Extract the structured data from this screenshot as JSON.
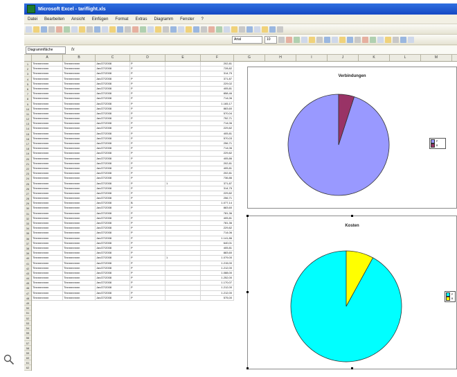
{
  "window": {
    "title": "Microsoft Excel - tariflight.xls"
  },
  "menu": [
    "Datei",
    "Bearbeiten",
    "Ansicht",
    "Einfügen",
    "Format",
    "Extras",
    "Diagramm",
    "Fenster",
    "?"
  ],
  "toolbar": {
    "font_name": "Arial",
    "font_size": "10"
  },
  "formula_bar": {
    "name_box": "Diagrammfläche",
    "fx": "fx"
  },
  "columns": [
    "A",
    "B",
    "C",
    "D",
    "E",
    "F",
    "G",
    "H",
    "I",
    "J",
    "K",
    "L",
    "M",
    "N"
  ],
  "row_numbers": [
    "1",
    "2",
    "3",
    "4",
    "5",
    "6",
    "7",
    "8",
    "9",
    "10",
    "11",
    "12",
    "13",
    "14",
    "15",
    "16",
    "17",
    "18",
    "19",
    "20",
    "21",
    "22",
    "23",
    "24",
    "25",
    "26",
    "27",
    "28",
    "29",
    "30",
    "31",
    "32",
    "33",
    "34",
    "35",
    "36",
    "37",
    "38",
    "39",
    "40",
    "41",
    "42",
    "43",
    "44",
    "45",
    "46",
    "47",
    "48",
    "49",
    "50",
    "51",
    "52",
    "53",
    "54",
    "55",
    "56",
    "57",
    "58",
    "59",
    "60",
    "61",
    "62"
  ],
  "rows": [
    {
      "a": "Tlnnnnnnnnn",
      "b": "Tlnnnnnnnnn",
      "c": "Jan/27/2008",
      "d": "P",
      "e": "",
      "f": "202,81"
    },
    {
      "a": "Tlnnnnnnnnn",
      "b": "Tlnnnnnnnnn",
      "c": "Jan/27/2008",
      "d": "P",
      "e": "",
      "f": "728,82"
    },
    {
      "a": "Tlnnnnnnnnn",
      "b": "Tlnnnnnnnnn",
      "c": "Jan/27/2008",
      "d": "P",
      "e": "",
      "f": "314,75"
    },
    {
      "a": "Tlnnnnnnnnn",
      "b": "Tlnnnnnnnnn",
      "c": "Jan/27/2008",
      "d": "P",
      "e": "",
      "f": "371,87"
    },
    {
      "a": "Tlnnnnnnnnn",
      "b": "Tlnnnnnnnnn",
      "c": "Jan/27/2008",
      "d": "P",
      "e": "",
      "f": "229,02"
    },
    {
      "a": "Tlnnnnnnnnn",
      "b": "Tlnnnnnnnnn",
      "c": "Jan/27/2008",
      "d": "P",
      "e": "",
      "f": "405,81"
    },
    {
      "a": "Tlnnnnnnnnn",
      "b": "Tlnnnnnnnnn",
      "c": "Jan/27/2008",
      "d": "P",
      "e": "",
      "f": "858,46"
    },
    {
      "a": "Tlnnnnnnnnn",
      "b": "Tlnnnnnnnnn",
      "c": "Jan/27/2008",
      "d": "P",
      "e": "",
      "f": "714,06"
    },
    {
      "a": "Tlnnnnnnnnn",
      "b": "Tlnnnnnnnnn",
      "c": "Jan/27/2008",
      "d": "P",
      "e": "",
      "f": "1.165,17"
    },
    {
      "a": "Tlnnnnnnnnn",
      "b": "Tlnnnnnnnnn",
      "c": "Jan/27/2008",
      "d": "P",
      "e": "",
      "f": "883,60"
    },
    {
      "a": "Tlnnnnnnnnn",
      "b": "Tlnnnnnnnnn",
      "c": "Jan/27/2008",
      "d": "P",
      "e": "",
      "f": "570,04"
    },
    {
      "a": "Tlnnnnnnnnn",
      "b": "Tlnnnnnnnnn",
      "c": "Jan/27/2008",
      "d": "P",
      "e": "",
      "f": "752,71"
    },
    {
      "a": "Tlnnnnnnnnn",
      "b": "Tlnnnnnnnnn",
      "c": "Jan/27/2008",
      "d": "P",
      "e": "",
      "f": "714,06"
    },
    {
      "a": "Tlnnnnnnnnn",
      "b": "Tlnnnnnnnnn",
      "c": "Jan/27/2008",
      "d": "P",
      "e": "",
      "f": "229,82"
    },
    {
      "a": "Tlnnnnnnnnn",
      "b": "Tlnnnnnnnnn",
      "c": "Jan/27/2008",
      "d": "P",
      "e": "",
      "f": "405,81"
    },
    {
      "a": "Tlnnnnnnnnn",
      "b": "Tlnnnnnnnnn",
      "c": "Jan/27/2008",
      "d": "P",
      "e": "",
      "f": "570,03"
    },
    {
      "a": "Tlnnnnnnnnn",
      "b": "Tlnnnnnnnnn",
      "c": "Jan/27/2008",
      "d": "P",
      "e": "",
      "f": "256,71"
    },
    {
      "a": "Tlnnnnnnnnn",
      "b": "Tlnnnnnnnnn",
      "c": "Jan/27/2008",
      "d": "P",
      "e": "",
      "f": "714,06"
    },
    {
      "a": "Tlnnnnnnnnn",
      "b": "Tlnnnnnnnnn",
      "c": "Jan/27/2008",
      "d": "P",
      "e": "",
      "f": "229,82"
    },
    {
      "a": "Tlnnnnnnnnn",
      "b": "Tlnnnnnnnnn",
      "c": "Jan/27/2008",
      "d": "P",
      "e": "",
      "f": "405,86"
    },
    {
      "a": "Tlnnnnnnnnn",
      "b": "Tlnnnnnnnnn",
      "c": "Jan/27/2008",
      "d": "P",
      "e": "",
      "f": "202,81"
    },
    {
      "a": "Tlnnnnnnnnn",
      "b": "Tlnnnnnnnnn",
      "c": "Jan/27/2008",
      "d": "P",
      "e": "",
      "f": "405,81"
    },
    {
      "a": "Tlnnnnnnnnn",
      "b": "Tlnnnnnnnnn",
      "c": "Jan/27/2008",
      "d": "P",
      "e": "",
      "f": "202,81"
    },
    {
      "a": "Tlnnnnnnnnn",
      "b": "Tlnnnnnnnnn",
      "c": "Jan/27/2008",
      "d": "P",
      "e": "",
      "f": "736,86"
    },
    {
      "a": "Tlnnnnnnnnn",
      "b": "Tlnnnnnnnnn",
      "c": "Jan/27/2008",
      "d": "P",
      "e": "1",
      "f": "371,87"
    },
    {
      "a": "Tlnnnnnnnnn",
      "b": "Tlnnnnnnnnn",
      "c": "Jan/27/2008",
      "d": "P",
      "e": "",
      "f": "314,75"
    },
    {
      "a": "Tlnnnnnnnnn",
      "b": "Tlnnnnnnnnn",
      "c": "Jan/27/2008",
      "d": "P",
      "e": "",
      "f": "229,82"
    },
    {
      "a": "Tlnnnnnnnnn",
      "b": "Tlnnnnnnnnn",
      "c": "Jan/27/2008",
      "d": "P",
      "e": "",
      "f": "256,71"
    },
    {
      "a": "Tlnnnnnnnnn",
      "b": "Tlnnnnnnnnn",
      "c": "Jan/27/2008",
      "d": "B",
      "e": "",
      "f": "1.077,14"
    },
    {
      "a": "Tlnnnnnnnnn",
      "b": "Tlnnnnnnnnn",
      "c": "Jan/27/2008",
      "d": "P",
      "e": "",
      "f": "883,60"
    },
    {
      "a": "Tlnnnnnnnnn",
      "b": "Tlnnnnnnnnn",
      "c": "Jan/27/2008",
      "d": "P",
      "e": "",
      "f": "781,36"
    },
    {
      "a": "Tlnnnnnnnnn",
      "b": "Tlnnnnnnnnn",
      "c": "Jan/27/2008",
      "d": "P",
      "e": "",
      "f": "405,81"
    },
    {
      "a": "Tlnnnnnnnnn",
      "b": "Tlnnnnnnnnn",
      "c": "Jan/27/2008",
      "d": "P",
      "e": "",
      "f": "781,36"
    },
    {
      "a": "Tlnnnnnnnnn",
      "b": "Tlnnnnnnnnn",
      "c": "Jan/27/2008",
      "d": "P",
      "e": "",
      "f": "229,82"
    },
    {
      "a": "Tlnnnnnnnnn",
      "b": "Tlnnnnnnnnn",
      "c": "Jan/27/2008",
      "d": "P",
      "e": "",
      "f": "714,06"
    },
    {
      "a": "Tlnnnnnnnnn",
      "b": "Tlnnnnnnnnn",
      "c": "Jan/27/2008",
      "d": "P",
      "e": "",
      "f": "1.141,86"
    },
    {
      "a": "Tlnnnnnnnnn",
      "b": "Tlnnnnnnnnn",
      "c": "Jan/27/2008",
      "d": "P",
      "e": "",
      "f": "640,01"
    },
    {
      "a": "Tlnnnnnnnnn",
      "b": "Tlnnnnnnnnn",
      "c": "Jan/27/2008",
      "d": "P",
      "e": "",
      "f": "405,81"
    },
    {
      "a": "Tlnnnnnnnnn",
      "b": "Tlnnnnnnnnn",
      "c": "Jan/27/2008",
      "d": "P",
      "e": "",
      "f": "883,60"
    },
    {
      "a": "Tlnnnnnnnnn",
      "b": "Tlnnnnnnnnn",
      "c": "Jan/27/2008",
      "d": "P",
      "e": "1",
      "f": "1.079,00"
    },
    {
      "a": "Tlnnnnnnnnn",
      "b": "Tlnnnnnnnnn",
      "c": "Jan/27/2008",
      "d": "P",
      "e": "",
      "f": "1.215,00"
    },
    {
      "a": "Tlnnnnnnnnn",
      "b": "Tlnnnnnnnnn",
      "c": "Jan/27/2008",
      "d": "P",
      "e": "",
      "f": "1.212,00"
    },
    {
      "a": "Tlnnnnnnnnn",
      "b": "Tlnnnnnnnnn",
      "c": "Jan/27/2008",
      "d": "P",
      "e": "",
      "f": "1.088,00"
    },
    {
      "a": "Tlnnnnnnnnn",
      "b": "Tlnnnnnnnnn",
      "c": "Jan/27/2008",
      "d": "P",
      "e": "",
      "f": "1.252,00"
    },
    {
      "a": "Tlnnnnnnnnn",
      "b": "Tlnnnnnnnnn",
      "c": "Jan/27/2008",
      "d": "P",
      "e": "",
      "f": "1.170,07"
    },
    {
      "a": "Tlnnnnnnnnn",
      "b": "Tlnnnnnnnnn",
      "c": "Jan/27/2008",
      "d": "P",
      "e": "",
      "f": "1.212,00"
    },
    {
      "a": "Tlnnnnnnnnn",
      "b": "Tlnnnnnnnnn",
      "c": "Jan/27/2008",
      "d": "P",
      "e": "",
      "f": "1.212,00"
    },
    {
      "a": "Tlnnnnnnnnn",
      "b": "Tlnnnnnnnnn",
      "c": "Jan/27/2008",
      "d": "P",
      "e": "",
      "f": "575,00"
    }
  ],
  "chart_data": [
    {
      "type": "pie",
      "title": "Verbindungen",
      "categories": [
        "P",
        "B"
      ],
      "values": [
        95,
        5
      ],
      "colors": [
        "#9999ff",
        "#993366"
      ]
    },
    {
      "type": "pie",
      "title": "Kosten",
      "categories": [
        "P",
        "B"
      ],
      "values": [
        92,
        8
      ],
      "colors": [
        "#00ffff",
        "#ffff00"
      ]
    }
  ]
}
